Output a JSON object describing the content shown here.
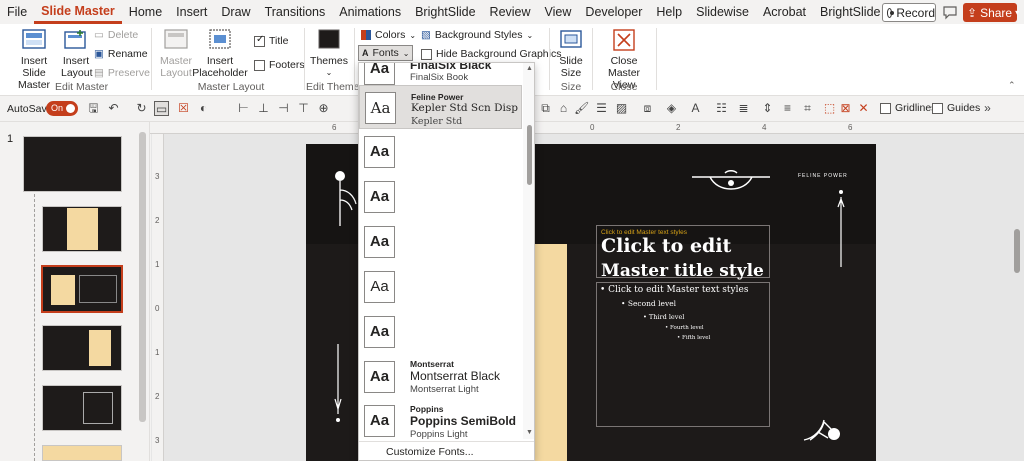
{
  "menubar": {
    "items": [
      "File",
      "Slide Master",
      "Home",
      "Insert",
      "Draw",
      "Transitions",
      "Animations",
      "BrightSlide",
      "Review",
      "View",
      "Developer",
      "Help",
      "Slidewise",
      "Acrobat",
      "BrightSlide"
    ],
    "active_index": 1,
    "record_label": "Record",
    "share_label": "Share"
  },
  "ribbon": {
    "insert_slide_master": "Insert Slide Master",
    "insert_layout": "Insert Layout",
    "delete": "Delete",
    "rename": "Rename",
    "preserve": "Preserve",
    "edit_master_group": "Edit Master",
    "master_layout": "Master Layout",
    "insert_placeholder": "Insert Placeholder",
    "title_cb": "Title",
    "footers_cb": "Footers",
    "master_layout_group": "Master Layout",
    "themes": "Themes",
    "edit_theme_group": "Edit Theme",
    "colors": "Colors",
    "fonts": "Fonts",
    "background_styles": "Background Styles",
    "hide_bg_graphics": "Hide Background Graphics",
    "slide_size": "Slide Size",
    "size_group": "Size",
    "close_master_view": "Close Master View",
    "close_group": "Close"
  },
  "qat": {
    "autosave_label": "AutoSave",
    "autosave_state": "On",
    "gridlines": "Gridlines",
    "guides": "Guides"
  },
  "thumbs": {
    "first_index": "1"
  },
  "ruler": {
    "h_ticks": [
      "6",
      "4",
      "2",
      "0",
      "2",
      "4",
      "6"
    ],
    "v_ticks": [
      "3",
      "2",
      "1",
      "0",
      "1",
      "2",
      "3"
    ]
  },
  "slide": {
    "brand_text": "FELINE POWER",
    "tiny_title": "Click to edit Master text styles",
    "title_line1": "Click to edit",
    "title_line2": "Master title style",
    "levels": [
      "Click to edit Master text styles",
      "Second level",
      "Third level",
      "Fourth level",
      "Fifth level"
    ]
  },
  "fonts_dropdown": {
    "items": [
      {
        "theme": "",
        "heading": "FinalSix Black",
        "body": "FinalSix Book"
      },
      {
        "theme": "Feline Power",
        "heading": "Kepler Std Scn Disp",
        "body": "Kepler Std"
      },
      {
        "theme": "",
        "heading": "",
        "body": ""
      },
      {
        "theme": "",
        "heading": "",
        "body": ""
      },
      {
        "theme": "",
        "heading": "",
        "body": ""
      },
      {
        "theme": "",
        "heading": "",
        "body": ""
      },
      {
        "theme": "",
        "heading": "",
        "body": ""
      },
      {
        "theme": "Montserrat",
        "heading": "Montserrat Black",
        "body": "Montserrat Light"
      },
      {
        "theme": "Poppins",
        "heading": "Poppins SemiBold",
        "body": "Poppins Light"
      }
    ],
    "aa_glyph": "Aa",
    "customize": "Customize Fonts..."
  },
  "colors": {
    "accent": "#c43e1c",
    "slide_bg": "#1d1a19",
    "cream": "#f4d9a1",
    "gold": "#d4a017"
  }
}
